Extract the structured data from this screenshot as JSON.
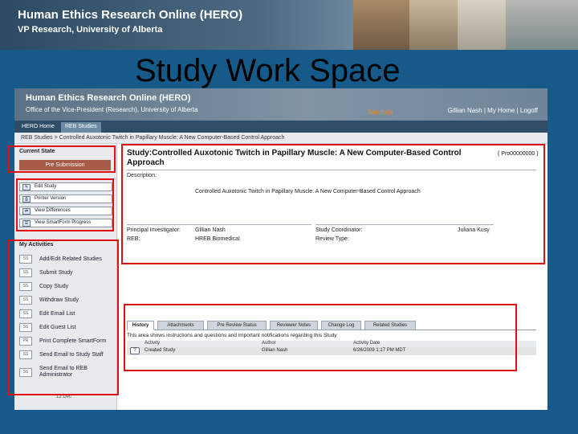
{
  "banner": {
    "title": "Human Ethics Research Online (HERO)",
    "subtitle": "VP Research, University of Alberta"
  },
  "slide_title": "Study Work Space",
  "app": {
    "title": "Human Ethics Research Online (HERO)",
    "subtitle": "Office of the Vice-President (Research), University of Alberta",
    "sandbox": "Sandbox",
    "user_links": "Gillian Nash | My Home | Logoff"
  },
  "tabs": [
    "HERO Home",
    "REB Studies"
  ],
  "breadcrumb": "REB Studies > Controlled Auxotonic Twitch in Papillary Muscle: A New Computer-Based Control Approach",
  "left": {
    "current_state_title": "Current State",
    "state_value": "Pre Submission",
    "actions": [
      {
        "icon": "edit-icon",
        "label": "Edit Study"
      },
      {
        "icon": "printer-icon",
        "label": "Printer Version"
      },
      {
        "icon": "differences-icon",
        "label": "View Differences"
      },
      {
        "icon": "smartform-icon",
        "label": "View SmartForm Progress"
      }
    ],
    "activities_title": "My Activities",
    "activities": [
      {
        "icon": "SS",
        "label": "Add/Edit Related Studies"
      },
      {
        "icon": "SS",
        "label": "Submit Study"
      },
      {
        "icon": "SS",
        "label": "Copy Study"
      },
      {
        "icon": "SS",
        "label": "Withdraw Study"
      },
      {
        "icon": "SS",
        "label": "Edit Email List"
      },
      {
        "icon": "SS",
        "label": "Edit Guest List"
      },
      {
        "icon": "PR",
        "label": "Print Complete SmartForm"
      },
      {
        "icon": "SS",
        "label": "Send Email to Study Staff"
      },
      {
        "icon": "SS",
        "label": "Send Email to REB Administrator"
      }
    ],
    "footer": "12 Dec"
  },
  "study": {
    "heading": "Study:Controlled Auxotonic Twitch in Papillary Muscle: A New Computer-Based Control Approach",
    "id": "( Pro00000000 )",
    "description_label": "Description:",
    "description": "Controlled Auxotonic Twitch in Papillary Muscle: A New Computer-Based Control Approach",
    "pi_label": "Principal Investigator:",
    "pi_value": "Gillian Nash",
    "coordinator_label": "Study Coordinator:",
    "coordinator_value": "Juliana Kusy",
    "reb_label": "REB:",
    "reb_value": "HREB Biomedical",
    "review_type_label": "Review Type:"
  },
  "history": {
    "tabs": [
      "History",
      "Attachments",
      "Pre Review Status",
      "Reviewer Notes",
      "Change Log",
      "Related Studies"
    ],
    "note": "This area shows instructions and questions and important notifications regarding this Study",
    "columns": [
      "Activity",
      "Author",
      "Activity Date"
    ],
    "rows": [
      {
        "activity": "Created Study",
        "author": "Gillian Nash",
        "date": "6/26/2009 1:17 PM MDT"
      }
    ]
  },
  "colors": {
    "background": "#165a8a",
    "highlight": "#e01010",
    "state_button": "#a85a48",
    "sandbox": "#e98b2c"
  }
}
